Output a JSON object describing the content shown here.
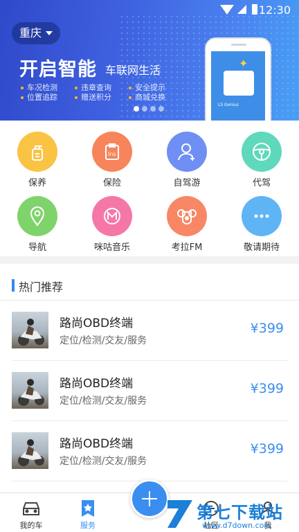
{
  "status_bar": {
    "time": "12:30"
  },
  "banner": {
    "city": "重庆",
    "headline": "开启智能",
    "subline": "车联网生活",
    "features": [
      "车况检测",
      "违章查询",
      "安全提示",
      "位置追踪",
      "赠送积分",
      "商城兑换"
    ],
    "device_label": "LS Genius",
    "page_count": 4,
    "active_page": 1
  },
  "services": [
    {
      "label": "保养",
      "icon": "oil-bottle-icon",
      "color": "#f9c344"
    },
    {
      "label": "保险",
      "icon": "insurance-clipboard-icon",
      "color": "#f7845b"
    },
    {
      "label": "自驾游",
      "icon": "user-add-icon",
      "color": "#6f8ff5"
    },
    {
      "label": "代驾",
      "icon": "steering-wheel-icon",
      "color": "#5fd8bb"
    },
    {
      "label": "导航",
      "icon": "location-pin-icon",
      "color": "#7fd36b"
    },
    {
      "label": "咪咕音乐",
      "icon": "music-icon",
      "color": "#f577a8"
    },
    {
      "label": "考拉FM",
      "icon": "koala-icon",
      "color": "#f88765"
    },
    {
      "label": "敬请期待",
      "icon": "more-icon",
      "color": "#5fb4f5"
    }
  ],
  "hot": {
    "title": "热门推荐",
    "items": [
      {
        "name": "路尚OBD终端",
        "desc": "定位/检测/交友/服务",
        "price": "¥399"
      },
      {
        "name": "路尚OBD终端",
        "desc": "定位/检测/交友/服务",
        "price": "¥399"
      },
      {
        "name": "路尚OBD终端",
        "desc": "定位/检测/交友/服务",
        "price": "¥399"
      }
    ]
  },
  "tabbar": {
    "tabs": [
      {
        "label": "我的车"
      },
      {
        "label": "服务"
      },
      {
        "label": "社区"
      },
      {
        "label": "我"
      }
    ]
  },
  "watermark": {
    "big": "第七下载站",
    "small": "www.d7down.com"
  },
  "colors": {
    "accent": "#3a8ef0",
    "banner_start": "#2f49c9",
    "banner_end": "#47a0f5"
  }
}
